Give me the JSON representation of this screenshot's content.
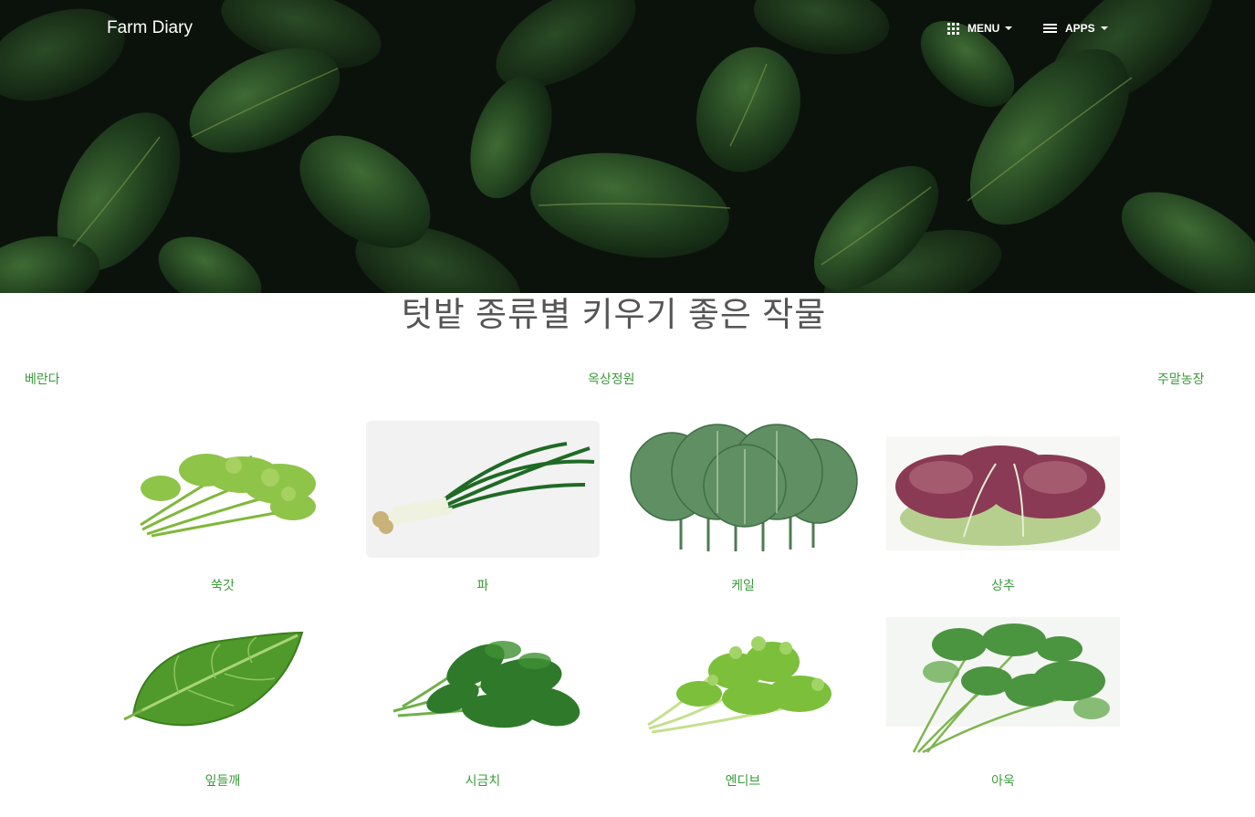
{
  "header": {
    "brand": "Farm Diary",
    "menu_label": "MENU",
    "apps_label": "APPS",
    "menu_icon": "grid-icon",
    "apps_icon": "list-icon",
    "hero_image": "dark-green-leaves-photo"
  },
  "main": {
    "title": "텃밭 종류별 키우기 좋은 작물",
    "tabs": [
      {
        "label": "베란다"
      },
      {
        "label": "옥상정원"
      },
      {
        "label": "주말농장"
      }
    ],
    "crops": [
      {
        "label": "쑥갓",
        "image": "crown-daisy-photo"
      },
      {
        "label": "파",
        "image": "green-onion-photo"
      },
      {
        "label": "케일",
        "image": "kale-photo"
      },
      {
        "label": "상추",
        "image": "lettuce-photo"
      },
      {
        "label": "잎들깨",
        "image": "perilla-leaf-photo"
      },
      {
        "label": "시금치",
        "image": "spinach-photo"
      },
      {
        "label": "엔디브",
        "image": "endive-photo"
      },
      {
        "label": "아욱",
        "image": "mallow-photo"
      }
    ]
  },
  "colors": {
    "accent_green": "#3a9b3a",
    "title_gray": "#555555",
    "hero_dark": "#0c130d"
  }
}
